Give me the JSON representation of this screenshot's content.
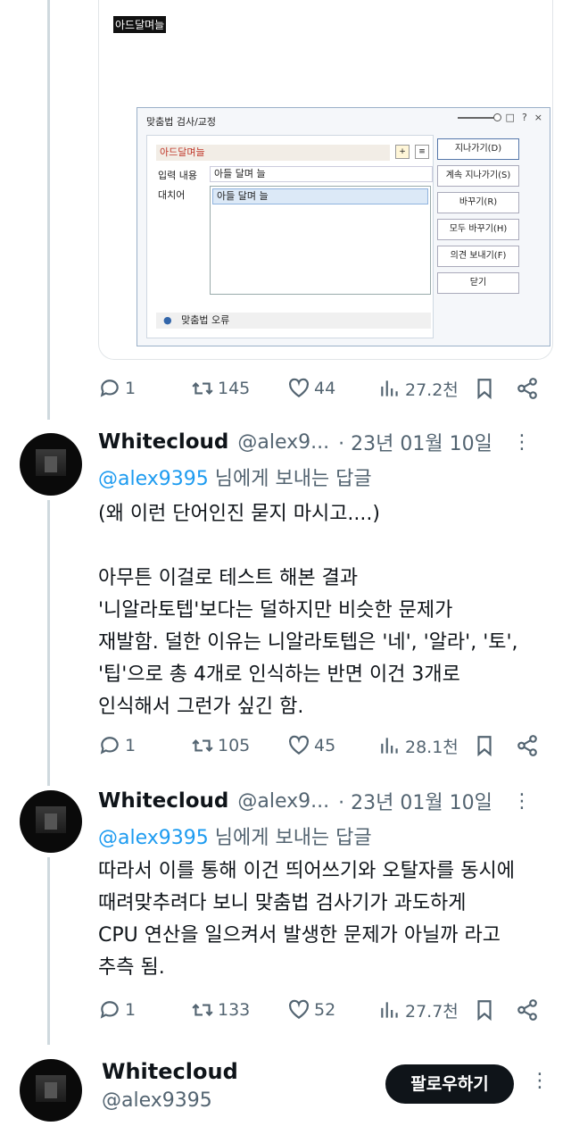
{
  "embed": {
    "highlighted_word": "아드달며늘",
    "dialog": {
      "title": "맞춤법 검사/교정",
      "controls": [
        "□",
        "?",
        "×"
      ],
      "error_word": "아드달며늘",
      "input_label": "입력 내용",
      "input_value": "아들 달며 늘",
      "suggestion_label": "대치어",
      "suggestion_selected": "아들 달며 늘",
      "status_text": "맞춤법 오류",
      "buttons": [
        "지나가기(D)",
        "계속 지나가기(S)",
        "바꾸기(R)",
        "모두 바꾸기(H)",
        "의견 보내기(F)",
        "닫기"
      ]
    }
  },
  "first_actions": {
    "replies": "1",
    "reposts": "145",
    "likes": "44",
    "views": "27.2천"
  },
  "posts": [
    {
      "name": "Whitecloud",
      "handle": "@alex9...",
      "date": "· 23년 01월 10일",
      "reply_to_handle": "@alex9395",
      "reply_to_suffix": " 님에게 보내는 답글",
      "text": "(왜 이런 단어인진 묻지 마시고....)\n\n아무튼 이걸로 테스트 해본 결과\n'니알라토텝'보다는 덜하지만 비슷한 문제가\n재발함. 덜한 이유는 니알라토텝은 '네', '알라', '토',\n'팁'으로 총 4개로 인식하는 반면 이건 3개로\n인식해서 그런가 싶긴 함.",
      "replies": "1",
      "reposts": "105",
      "likes": "45",
      "views": "28.1천"
    },
    {
      "name": "Whitecloud",
      "handle": "@alex9...",
      "date": "· 23년 01월 10일",
      "reply_to_handle": "@alex9395",
      "reply_to_suffix": " 님에게 보내는 답글",
      "text": "따라서 이를 통해 이건 띄어쓰기와 오탈자를 동시에\n때려맞추려다 보니 맞춤법 검사기가 과도하게\nCPU 연산을 일으켜서 발생한 문제가 아닐까 라고\n추측 됨.",
      "replies": "1",
      "reposts": "133",
      "likes": "52",
      "views": "27.7천"
    }
  ],
  "profile": {
    "name": "Whitecloud",
    "handle": "@alex9395",
    "follow_label": "팔로우하기"
  }
}
